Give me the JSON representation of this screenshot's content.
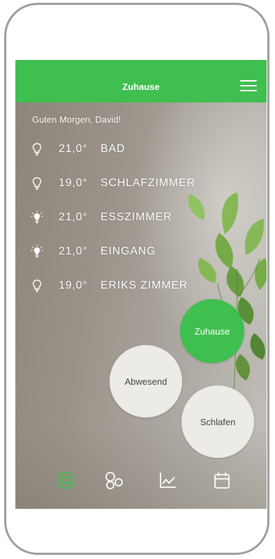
{
  "colors": {
    "accent": "#3fbf4f",
    "text_light": "#ffffff",
    "button_light": "#ecebe8",
    "button_text": "#444444"
  },
  "header": {
    "title": "Zuhause",
    "menu_icon": "hamburger-menu-icon"
  },
  "greeting": "Guten Morgen, David!",
  "rooms": [
    {
      "temperature": "21,0°",
      "name": "BAD",
      "light_state": "off",
      "icon": "bulb-outline-icon"
    },
    {
      "temperature": "19,0°",
      "name": "SCHLAFZIMMER",
      "light_state": "off",
      "icon": "bulb-outline-icon"
    },
    {
      "temperature": "21,0°",
      "name": "ESSZIMMER",
      "light_state": "on",
      "icon": "bulb-lit-icon"
    },
    {
      "temperature": "21,0°",
      "name": "EINGANG",
      "light_state": "on",
      "icon": "bulb-lit-icon"
    },
    {
      "temperature": "19,0°",
      "name": "ERIKS ZIMMER",
      "light_state": "off",
      "icon": "bulb-outline-icon"
    }
  ],
  "modes": [
    {
      "label": "Zuhause",
      "active": true
    },
    {
      "label": "Abwesend",
      "active": false
    },
    {
      "label": "Schlafen",
      "active": false
    }
  ],
  "bottom_nav": [
    {
      "icon": "at-sign-icon",
      "active": true
    },
    {
      "icon": "rooms-circles-icon",
      "active": false
    },
    {
      "icon": "line-chart-icon",
      "active": false
    },
    {
      "icon": "calendar-icon",
      "active": false
    }
  ]
}
